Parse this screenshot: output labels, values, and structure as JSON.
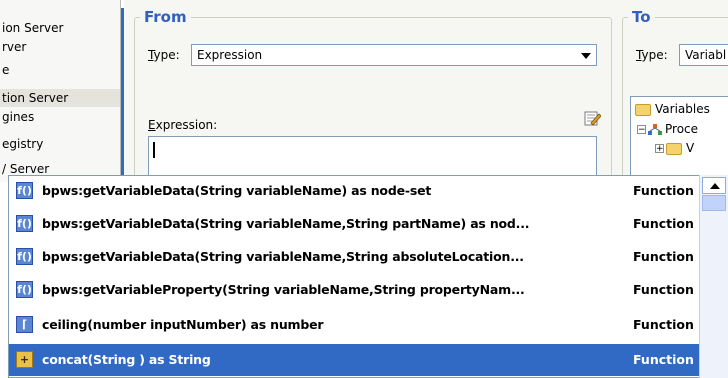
{
  "left_panel": {
    "items": [
      {
        "label": "ion Server"
      },
      {
        "label": "rver"
      },
      {
        "label": "e"
      },
      {
        "label": "tion Server",
        "selected": true
      },
      {
        "label": "gines"
      },
      {
        "label": "egistry"
      },
      {
        "label": "/ Server"
      }
    ]
  },
  "from": {
    "legend": "From",
    "type_label": "Type:",
    "type_label_mnemonic": "T",
    "type_label_rest": "ype:",
    "type_value": "Expression",
    "expression_label": "Expression:",
    "expression_label_mnemonic": "E",
    "expression_label_rest": "xpression:",
    "expression_value": ""
  },
  "to": {
    "legend": "To",
    "type_label_mnemonic": "T",
    "type_label_rest": "ype:",
    "type_value": "Variabl",
    "tree": [
      {
        "label": "Variables"
      },
      {
        "label": "Proce"
      },
      {
        "label": "V"
      }
    ]
  },
  "autocomplete": {
    "items": [
      {
        "icon": "f()",
        "name": "bpws:getVariableData(String variableName) as node-set",
        "type": "Function",
        "selected": false
      },
      {
        "icon": "f()",
        "name": "bpws:getVariableData(String variableName,String partName) as nod...",
        "type": "Function",
        "selected": false
      },
      {
        "icon": "f()",
        "name": "bpws:getVariableData(String variableName,String absoluteLocation...",
        "type": "Function",
        "selected": false
      },
      {
        "icon": "f()",
        "name": "bpws:getVariableProperty(String variableName,String propertyNam...",
        "type": "Function",
        "selected": false
      },
      {
        "icon": "⌈",
        "name": "ceiling(number inputNumber) as number",
        "type": "Function",
        "selected": false
      },
      {
        "icon": "+",
        "name": "concat(String ) as String",
        "type": "Function",
        "selected": true
      }
    ]
  },
  "colors": {
    "selection": "#316ac5",
    "legend": "#3060c0",
    "icon_bg": "#5b86d4"
  }
}
